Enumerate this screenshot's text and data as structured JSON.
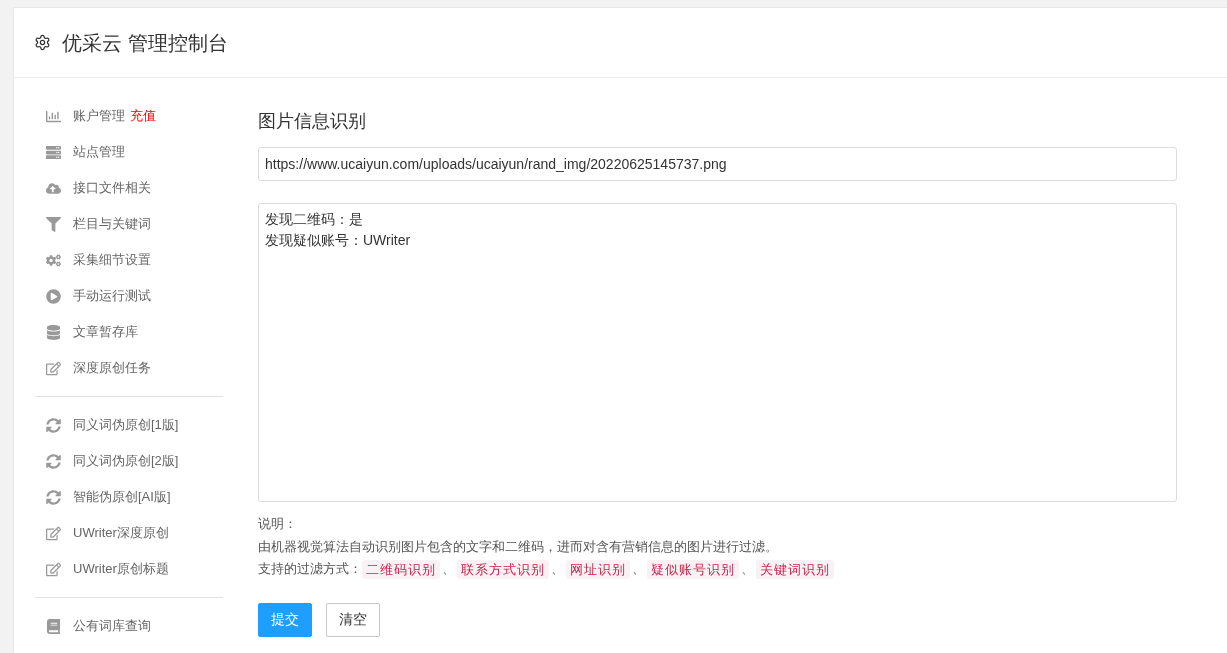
{
  "header": {
    "title": "优采云 管理控制台"
  },
  "sidebar": {
    "groups": [
      {
        "items": [
          {
            "label": "账户管理",
            "link": "充值"
          },
          {
            "label": "站点管理"
          },
          {
            "label": "接口文件相关"
          },
          {
            "label": "栏目与关键词"
          },
          {
            "label": "采集细节设置"
          },
          {
            "label": "手动运行测试"
          },
          {
            "label": "文章暂存库"
          },
          {
            "label": "深度原创任务"
          }
        ]
      },
      {
        "items": [
          {
            "label": "同义词伪原创[1版]"
          },
          {
            "label": "同义词伪原创[2版]"
          },
          {
            "label": "智能伪原创[AI版]"
          },
          {
            "label": "UWriter深度原创"
          },
          {
            "label": "UWriter原创标题"
          }
        ]
      },
      {
        "items": [
          {
            "label": "公有词库查询"
          }
        ]
      }
    ]
  },
  "main": {
    "title": "图片信息识别",
    "url_field": {
      "value": "https://www.ucaiyun.com/uploads/ucaiyun/rand_img/20220625145737.png"
    },
    "result_area": {
      "lines": [
        "发现二维码：是",
        "发现疑似账号：UWriter"
      ]
    },
    "notes": {
      "heading": "说明：",
      "description": "由机器视觉算法自动识别图片包含的文字和二维码，进而对含有营销信息的图片进行过滤。",
      "filters": {
        "label": "支持的过滤方式：",
        "methods": [
          {
            "label": "二维码识别",
            "separator": "、"
          },
          {
            "label": "联系方式识别",
            "separator": "、"
          },
          {
            "label": "网址识别",
            "separator": "、"
          },
          {
            "label": "疑似账号识别",
            "separator": "、"
          },
          {
            "label": "关键词识别"
          }
        ]
      }
    },
    "buttons": [
      {
        "label": "提交",
        "kind": "primary"
      },
      {
        "label": "清空",
        "kind": "default"
      }
    ]
  }
}
